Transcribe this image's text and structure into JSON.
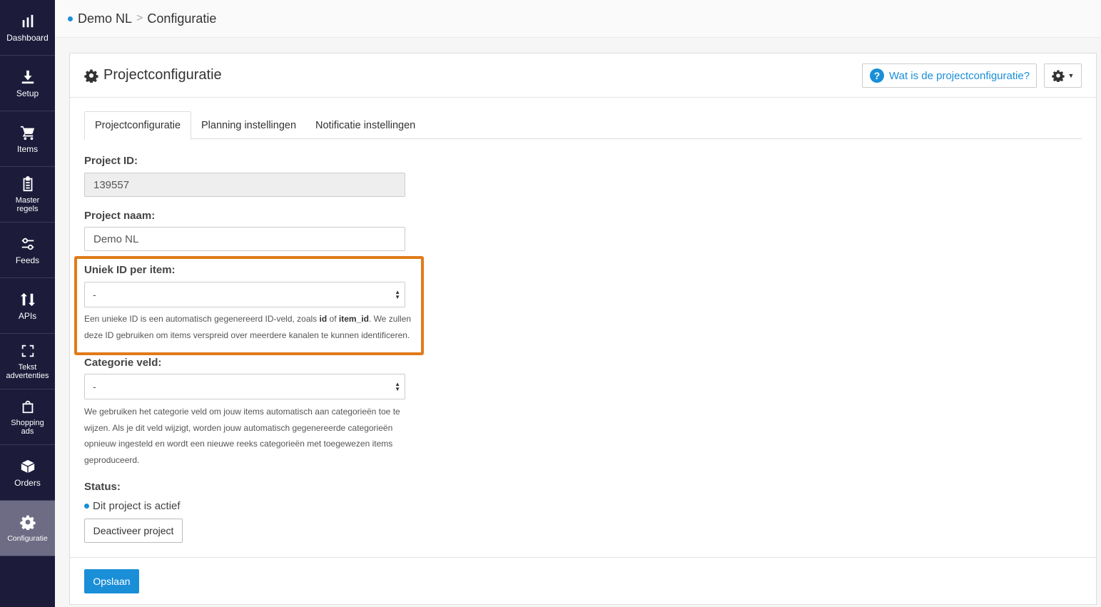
{
  "sidebar": {
    "items": [
      {
        "label": "Dashboard",
        "icon": "bar-chart-icon"
      },
      {
        "label": "Setup",
        "icon": "download-icon"
      },
      {
        "label": "Items",
        "icon": "cart-icon"
      },
      {
        "label": "Master regels",
        "icon": "clipboard-icon"
      },
      {
        "label": "Feeds",
        "icon": "sliders-icon"
      },
      {
        "label": "APIs",
        "icon": "arrows-updown-icon"
      },
      {
        "label": "Tekst advertenties",
        "icon": "frame-icon"
      },
      {
        "label": "Shopping ads",
        "icon": "bag-icon"
      },
      {
        "label": "Orders",
        "icon": "box-icon"
      },
      {
        "label": "Configuratie",
        "icon": "gear-icon"
      }
    ],
    "active": "Configuratie"
  },
  "breadcrumb": {
    "project": "Demo NL",
    "separator": ">",
    "page": "Configuratie"
  },
  "panel": {
    "title": "Projectconfiguratie",
    "help_button": "Wat is de projectconfiguratie?"
  },
  "tabs": [
    {
      "label": "Projectconfiguratie",
      "active": true
    },
    {
      "label": "Planning instellingen",
      "active": false
    },
    {
      "label": "Notificatie instellingen",
      "active": false
    }
  ],
  "form": {
    "project_id_label": "Project ID:",
    "project_id_value": "139557",
    "project_name_label": "Project naam:",
    "project_name_value": "Demo NL",
    "unique_id_label": "Uniek ID per item:",
    "unique_id_value": "-",
    "unique_id_help_1": "Een unieke ID is een automatisch gegenereerd ID-veld, zoals ",
    "unique_id_help_b1": "id",
    "unique_id_help_2": " of ",
    "unique_id_help_b2": "item_id",
    "unique_id_help_3": ". We zullen deze ID gebruiken om items verspreid over meerdere kanalen te kunnen identificeren.",
    "category_label": "Categorie veld:",
    "category_value": "-",
    "category_help": "We gebruiken het categorie veld om jouw items automatisch aan categorieën toe te wijzen. Als je dit veld wijzigt, worden jouw automatisch gegenereerde categorieën opnieuw ingesteld en wordt een nieuwe reeks categorieën met toegewezen items geproduceerd.",
    "status_label": "Status:",
    "status_text": "Dit project is actief",
    "deactivate_button": "Deactiveer project"
  },
  "footer": {
    "save_button": "Opslaan"
  },
  "colors": {
    "sidebar_bg": "#1c1b3a",
    "accent": "#1a8fd8",
    "highlight": "#e07b1a"
  }
}
